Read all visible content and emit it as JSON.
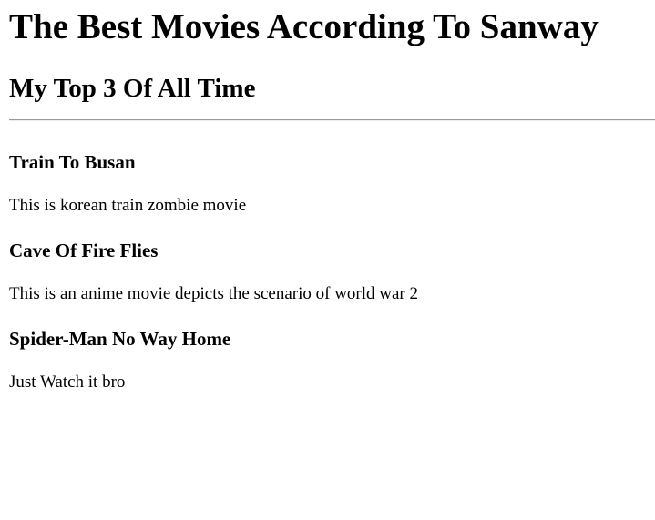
{
  "page": {
    "title": "The Best Movies According To Sanway",
    "subtitle": "My Top 3 Of All Time"
  },
  "movies": [
    {
      "title": "Train To Busan",
      "description": "This is korean train zombie movie"
    },
    {
      "title": "Cave Of Fire Flies",
      "description": "This is an anime movie depicts the scenario of world war 2"
    },
    {
      "title": "Spider-Man No Way Home",
      "description": "Just Watch it bro"
    }
  ]
}
